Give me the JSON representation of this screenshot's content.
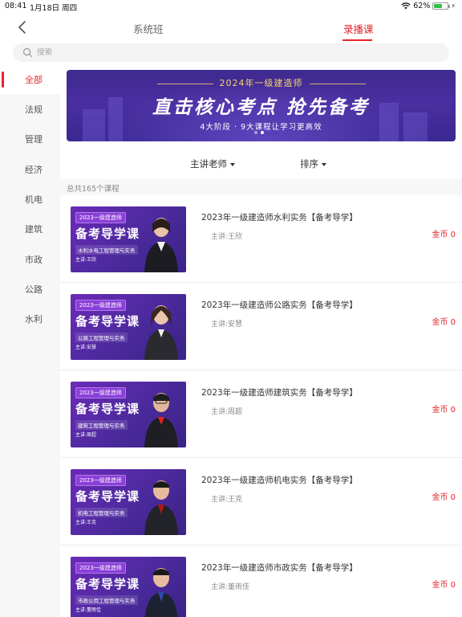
{
  "status_bar": {
    "time": "08:41",
    "date": "1月18日 周四",
    "battery": "62%",
    "battery_level": 0.62
  },
  "nav": {
    "tabs": [
      {
        "label": "系统班"
      },
      {
        "label": "录播课"
      }
    ],
    "active_tab": 1
  },
  "search": {
    "placeholder": "搜索"
  },
  "sidebar": {
    "items": [
      {
        "label": "全部"
      },
      {
        "label": "法规"
      },
      {
        "label": "管理"
      },
      {
        "label": "经济"
      },
      {
        "label": "机电"
      },
      {
        "label": "建筑"
      },
      {
        "label": "市政"
      },
      {
        "label": "公路"
      },
      {
        "label": "水利"
      }
    ],
    "active": 0
  },
  "banner": {
    "subtitle": "2024年一级建造师",
    "headline": "直击核心考点  抢先备考",
    "tagline": "4大阶段 · 9大课程让学习更高效",
    "dots": 2,
    "active_dot": 1
  },
  "filters": {
    "teacher": "主讲老师",
    "sort": "排序"
  },
  "total": "总共165个课程",
  "courses": [
    {
      "title": "2023年一级建造师水利实务【备考导学】",
      "teacher": "主讲:王欣",
      "price": "金币 0",
      "thumb": {
        "badge": "2023一级建造师",
        "big": "备考导学课",
        "subject": "水利水电工程管理与实务",
        "teacher": "主讲:王欣"
      }
    },
    {
      "title": "2023年一级建造师公路实务【备考导学】",
      "teacher": "主讲:安慧",
      "price": "金币 0",
      "thumb": {
        "badge": "2023一级建造师",
        "big": "备考导学课",
        "subject": "公路工程管理与实务",
        "teacher": "主讲:安慧"
      }
    },
    {
      "title": "2023年一级建造师建筑实务【备考导学】",
      "teacher": "主讲:周超",
      "price": "金币 0",
      "thumb": {
        "badge": "2023一级建造师",
        "big": "备考导学课",
        "subject": "建筑工程管理与实务",
        "teacher": "主讲:周超"
      }
    },
    {
      "title": "2023年一级建造师机电实务【备考导学】",
      "teacher": "主讲:王克",
      "price": "金币 0",
      "thumb": {
        "badge": "2023一级建造师",
        "big": "备考导学课",
        "subject": "机电工程管理与实务",
        "teacher": "主讲:王克"
      }
    },
    {
      "title": "2023年一级建造师市政实务【备考导学】",
      "teacher": "主讲:董雨佳",
      "price": "金币 0",
      "thumb": {
        "badge": "2023一级建造师",
        "big": "备考导学课",
        "subject": "市政公用工程管理与实务",
        "teacher": "主讲:董雨佳"
      }
    }
  ],
  "colors": {
    "accent": "#e8242a",
    "banner": "#4a2fa0",
    "thumb": "#6a2bb8"
  }
}
